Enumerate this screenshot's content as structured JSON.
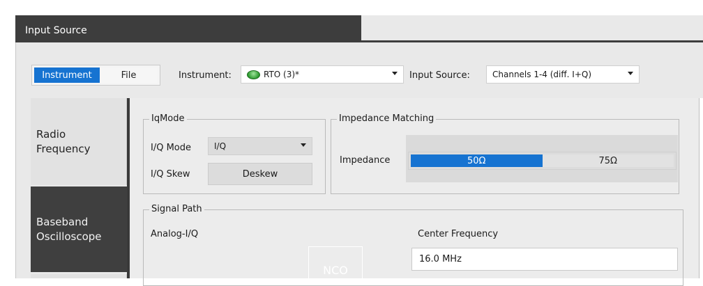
{
  "window": {
    "title": "Input Source"
  },
  "source_toggle": {
    "options": [
      "Instrument",
      "File"
    ],
    "selected": "Instrument"
  },
  "instrument": {
    "label": "Instrument:",
    "value": "RTO (3)*"
  },
  "input_source": {
    "label": "Input Source:",
    "value": "Channels 1-4 (diff. I+Q)"
  },
  "nav": {
    "items": [
      {
        "line1": "Radio",
        "line2": "Frequency"
      },
      {
        "line1": "Baseband",
        "line2": "Oscilloscope"
      }
    ],
    "selected": "Baseband Oscilloscope"
  },
  "iq_mode": {
    "group_title": "IqMode",
    "mode_label": "I/Q Mode",
    "mode_value": "I/Q",
    "skew_label": "I/Q Skew",
    "deskew_button": "Deskew"
  },
  "impedance": {
    "group_title": "Impedance Matching",
    "label": "Impedance",
    "options": [
      "50Ω",
      "75Ω"
    ],
    "selected": "50Ω"
  },
  "signal_path": {
    "group_title": "Signal Path",
    "label": "Analog-I/Q",
    "nco_label": "NCO",
    "center_frequency_label": "Center Frequency",
    "center_frequency_value": "16.0 MHz"
  },
  "colors": {
    "accent": "#1673d1",
    "dark": "#3d3d3d",
    "panel": "#ececec"
  }
}
